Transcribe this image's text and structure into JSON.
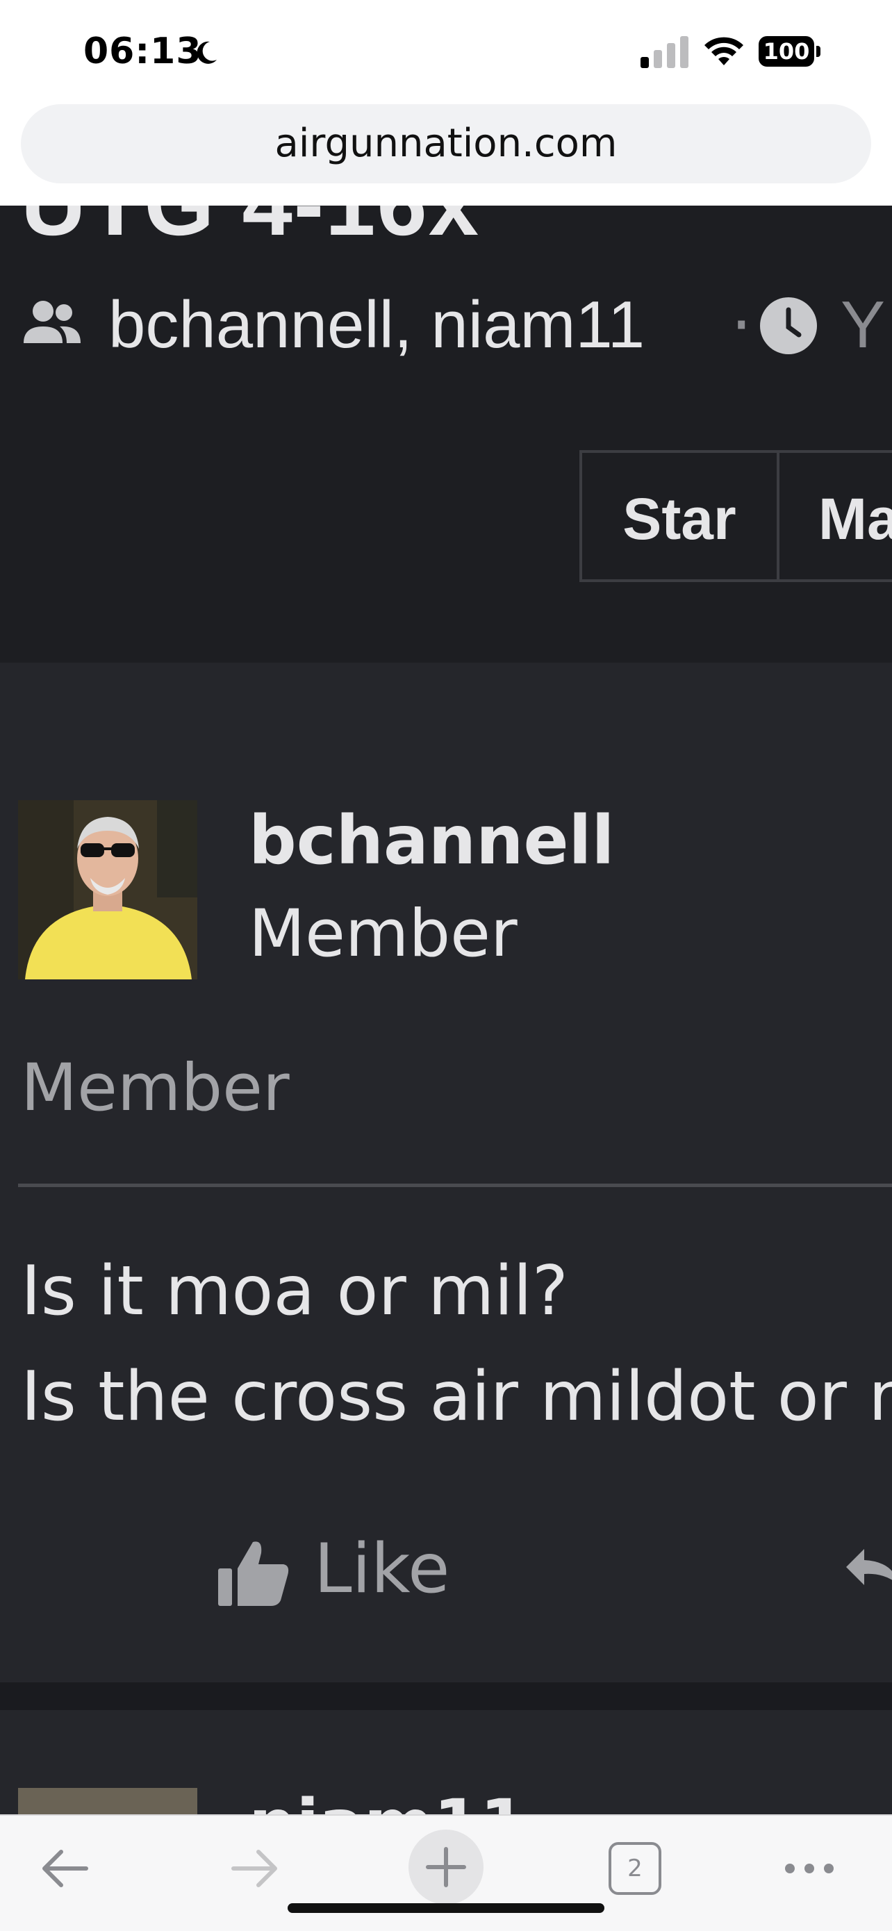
{
  "status_bar": {
    "time": "06:13",
    "battery": "100",
    "icons": [
      "moon-icon",
      "signal-icon",
      "wifi-icon",
      "battery-icon"
    ]
  },
  "browser": {
    "url": "airgunnation.com",
    "tabs_count": "2",
    "toolbar_icons": [
      "back-arrow-icon",
      "forward-arrow-icon",
      "new-tab-plus-icon",
      "tabs-icon",
      "more-icon"
    ]
  },
  "thread": {
    "title_partial": "UTG 4-16x",
    "participants": "bchannell, niam11",
    "separator": "·",
    "date_partial": "Y",
    "buttons": {
      "star": "Star",
      "mark": "Ma"
    }
  },
  "post": {
    "author": "bchannell",
    "role": "Member",
    "role_banner": "Member",
    "body": [
      "Is it moa or mil?",
      "Is the cross air mildot or m"
    ],
    "like_label": "Like"
  },
  "next_post": {
    "author_partial": "niam11"
  },
  "colors": {
    "page_bg": "#1d1e22",
    "post_bg": "#25262b",
    "text": "#e6e6e8",
    "muted": "#a2a3a7"
  }
}
